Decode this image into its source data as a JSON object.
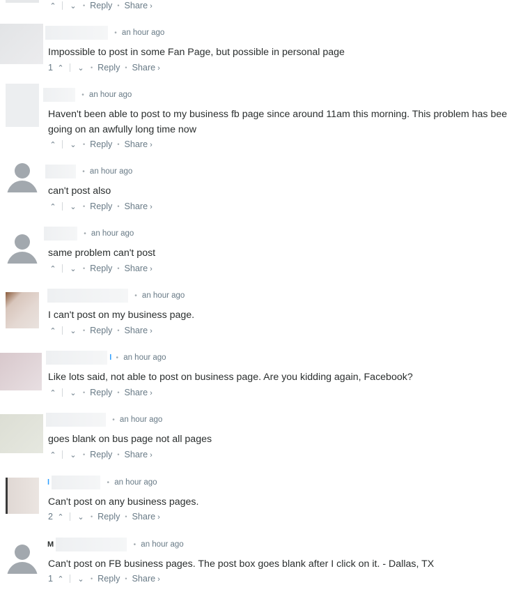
{
  "top_actions": {
    "reply": "Reply",
    "share": "Share"
  },
  "comments": [
    {
      "name_fragment": "",
      "time": "an hour ago",
      "text": "Impossible to post in some Fan Page, but possible in personal page",
      "upvotes": "1",
      "reply": "Reply",
      "share": "Share"
    },
    {
      "name_fragment": "",
      "time": "an hour ago",
      "text": "Haven't been able to post to my business fb page since around 11am this morning. This problem has bee",
      "text2": "going on an awfully long time now",
      "upvotes": "",
      "reply": "Reply",
      "share": "Share"
    },
    {
      "name_fragment": "",
      "time": "an hour ago",
      "text": "can't post also",
      "upvotes": "",
      "reply": "Reply",
      "share": "Share"
    },
    {
      "name_fragment": "",
      "time": "an hour ago",
      "text": "same problem can't post",
      "upvotes": "",
      "reply": "Reply",
      "share": "Share"
    },
    {
      "name_fragment": "",
      "time": "an hour ago",
      "text": "I can't post on my business page.",
      "upvotes": "",
      "reply": "Reply",
      "share": "Share"
    },
    {
      "name_fragment": "l",
      "time": "an hour ago",
      "text": "Like lots said, not able to post on business page. Are you kidding again, Facebook?",
      "upvotes": "",
      "reply": "Reply",
      "share": "Share"
    },
    {
      "name_fragment": "",
      "time": "an hour ago",
      "text": "goes blank on bus page not all pages",
      "upvotes": "",
      "reply": "Reply",
      "share": "Share"
    },
    {
      "name_fragment": "l",
      "time": "an hour ago",
      "text": "Can't post on any business pages.",
      "upvotes": "2",
      "reply": "Reply",
      "share": "Share"
    },
    {
      "name_fragment": "M",
      "time": "an hour ago",
      "text": "Can't post on FB business pages. The post box goes blank after I click on it. - Dallas, TX",
      "upvotes": "1",
      "reply": "Reply",
      "share": "Share"
    }
  ],
  "icons": {
    "upvote": "chevron-up-icon",
    "downvote": "chevron-down-icon",
    "share": "chevron-right-icon"
  }
}
